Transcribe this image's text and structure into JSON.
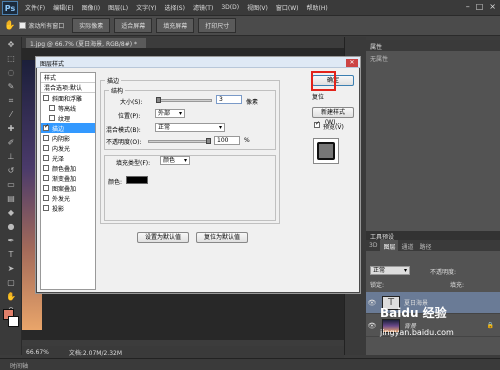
{
  "app": {
    "logo": "Ps"
  },
  "menubar": {
    "items": [
      "文件(F)",
      "编辑(E)",
      "图像(I)",
      "图层(L)",
      "文字(Y)",
      "选择(S)",
      "滤镜(T)",
      "3D(D)",
      "视图(V)",
      "窗口(W)",
      "帮助(H)"
    ],
    "win_controls": [
      "–",
      "□",
      "×"
    ]
  },
  "optionsbar": {
    "checkbox_label": "滚动所有窗口",
    "buttons": [
      "实际像素",
      "适合屏幕",
      "填充屏幕",
      "打印尺寸"
    ]
  },
  "document": {
    "tab_title": "1.jpg @ 66.7% (夏日海景, RGB/8#) *",
    "zoom": "66.67%",
    "doc_size": "文档:2.07M/2.32M"
  },
  "bottom_tab": "时间轴",
  "properties": {
    "title": "属性",
    "body": "无属性"
  },
  "layers": {
    "panel_title": "工具预设",
    "tabs": [
      "3D",
      "图层",
      "通道",
      "路径"
    ],
    "blend_mode": "正常",
    "opacity_label": "不透明度:",
    "lock_label": "锁定:",
    "fill_label": "填充:",
    "rows": [
      {
        "name": "夏日海景",
        "type": "text"
      },
      {
        "name": "背景",
        "type": "image"
      }
    ]
  },
  "dialog": {
    "title": "图层样式",
    "styles_header": "样式",
    "blend_options": "混合选项:默认",
    "style_items": [
      {
        "label": "斜面和浮雕",
        "checked": false,
        "sub": false
      },
      {
        "label": "等高线",
        "checked": false,
        "sub": true
      },
      {
        "label": "纹理",
        "checked": false,
        "sub": true
      },
      {
        "label": "描边",
        "checked": true,
        "sub": false,
        "selected": true
      },
      {
        "label": "内阴影",
        "checked": false,
        "sub": false
      },
      {
        "label": "内发光",
        "checked": false,
        "sub": false
      },
      {
        "label": "光泽",
        "checked": false,
        "sub": false
      },
      {
        "label": "颜色叠加",
        "checked": false,
        "sub": false
      },
      {
        "label": "渐变叠加",
        "checked": false,
        "sub": false
      },
      {
        "label": "图案叠加",
        "checked": false,
        "sub": false
      },
      {
        "label": "外发光",
        "checked": false,
        "sub": false
      },
      {
        "label": "投影",
        "checked": false,
        "sub": false
      }
    ],
    "stroke_group": "描边",
    "structure_group": "结构",
    "size_label": "大小(S):",
    "size_value": "3",
    "size_unit": "像素",
    "position_label": "位置(P):",
    "position_value": "外部",
    "blend_label": "混合模式(B):",
    "blend_value": "正常",
    "opacity_label": "不透明度(O):",
    "opacity_value": "100",
    "opacity_unit": "%",
    "fill_type_label": "填充类型(F):",
    "fill_type_value": "颜色",
    "color_label": "颜色:",
    "stroke_color": "#000000",
    "btn_set_default": "设置为默认值",
    "btn_reset_default": "复位为默认值",
    "btn_ok": "确定",
    "btn_reset": "复位",
    "btn_new_style": "新建样式(W)...",
    "preview_label": "预览(V)"
  },
  "watermark": {
    "line1": "Baidu 经验",
    "line2": "jingyan.baidu.com"
  }
}
